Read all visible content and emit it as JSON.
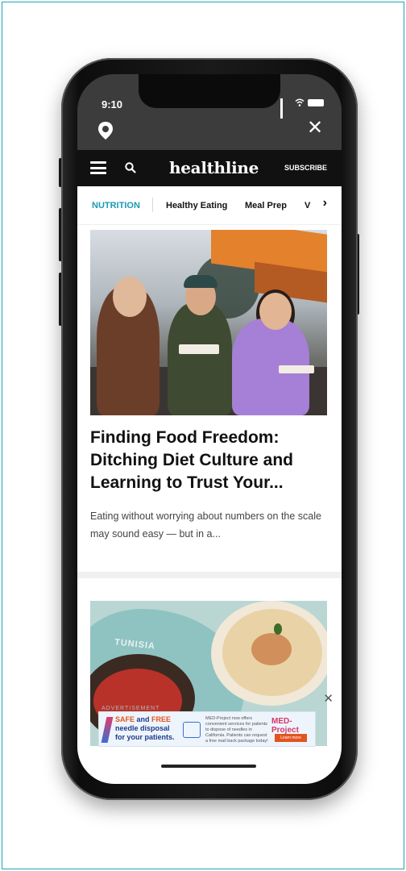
{
  "status_bar": {
    "time": "9:10"
  },
  "browser": {
    "close_glyph": "✕"
  },
  "site_header": {
    "logo": "healthline",
    "subscribe": "SUBSCRIBE"
  },
  "category_nav": {
    "active": "NUTRITION",
    "items": [
      "Healthy Eating",
      "Meal Prep",
      "V"
    ],
    "more_glyph": "›"
  },
  "article": {
    "headline": "Finding Food Freedom: Ditching Diet Culture and Learning to Trust Your...",
    "excerpt": "Eating without worrying about numbers on the scale may sound easy — but in a..."
  },
  "second_article": {
    "map_label": "TUNISIA"
  },
  "advertisement": {
    "label": "ADVERTISEMENT",
    "close_glyph": "✕",
    "headline_hl": "SAFE",
    "headline_and": " and ",
    "headline_free": "FREE",
    "line2": "needle disposal",
    "line3": "for your patients.",
    "description": "MED-Project now offers convenient services for patients to dispose of needles in California. Patients can request a free mail back package today!",
    "brand": "MED-Project",
    "cta": "Learn more"
  },
  "colors": {
    "accent": "#1a9bb3",
    "header_bg": "#111111",
    "frame_border": "#1aa7b8"
  }
}
